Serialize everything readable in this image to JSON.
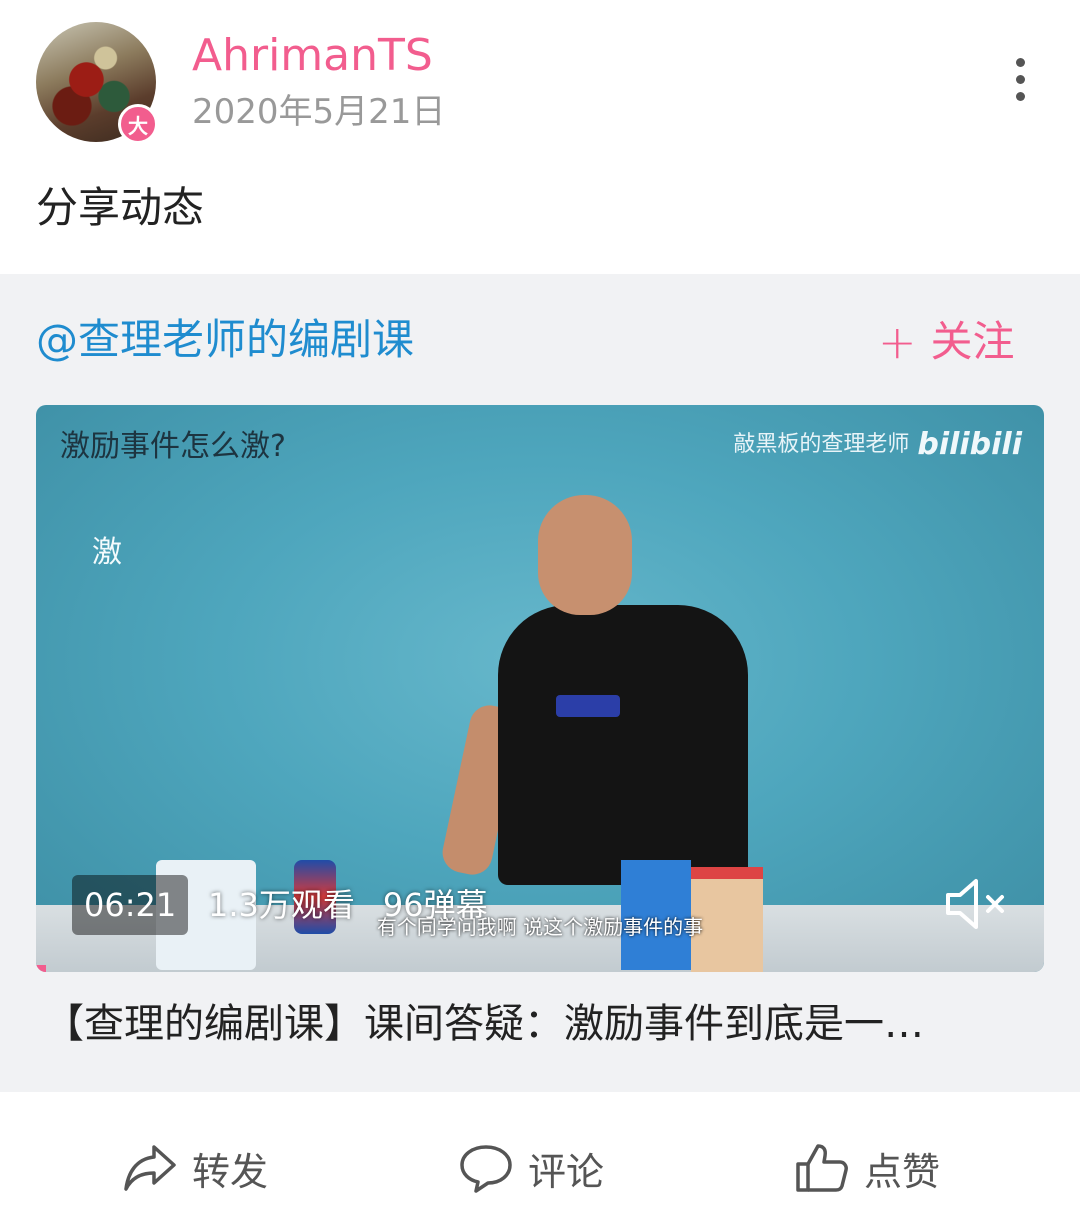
{
  "post": {
    "username": "AhrimanTS",
    "badge": "大",
    "date": "2020年5月21日",
    "text": "分享动态"
  },
  "share": {
    "author": "@查理老师的编剧课",
    "follow_plus": "+",
    "follow_label": "关注"
  },
  "video": {
    "overlay_title": "激励事件怎么激?",
    "watermark_text": "敲黑板的查理老师",
    "watermark_logo": "bilibili",
    "chalk_text": "激",
    "subtitle": "有个同学问我啊  说这个激励事件的事",
    "duration": "06:21",
    "views": "1.3万观看",
    "danmaku": "96弹幕",
    "muted": true,
    "caption": "【查理的编剧课】课间答疑：激励事件到底是一…"
  },
  "actions": [
    {
      "icon": "share-arrow-icon",
      "label": "转发"
    },
    {
      "icon": "comment-bubble-icon",
      "label": "评论"
    },
    {
      "icon": "thumbs-up-icon",
      "label": "点赞"
    }
  ],
  "colors": {
    "accent": "#f25d8e",
    "link": "#1f8ccf",
    "card_bg": "#f1f2f4"
  }
}
